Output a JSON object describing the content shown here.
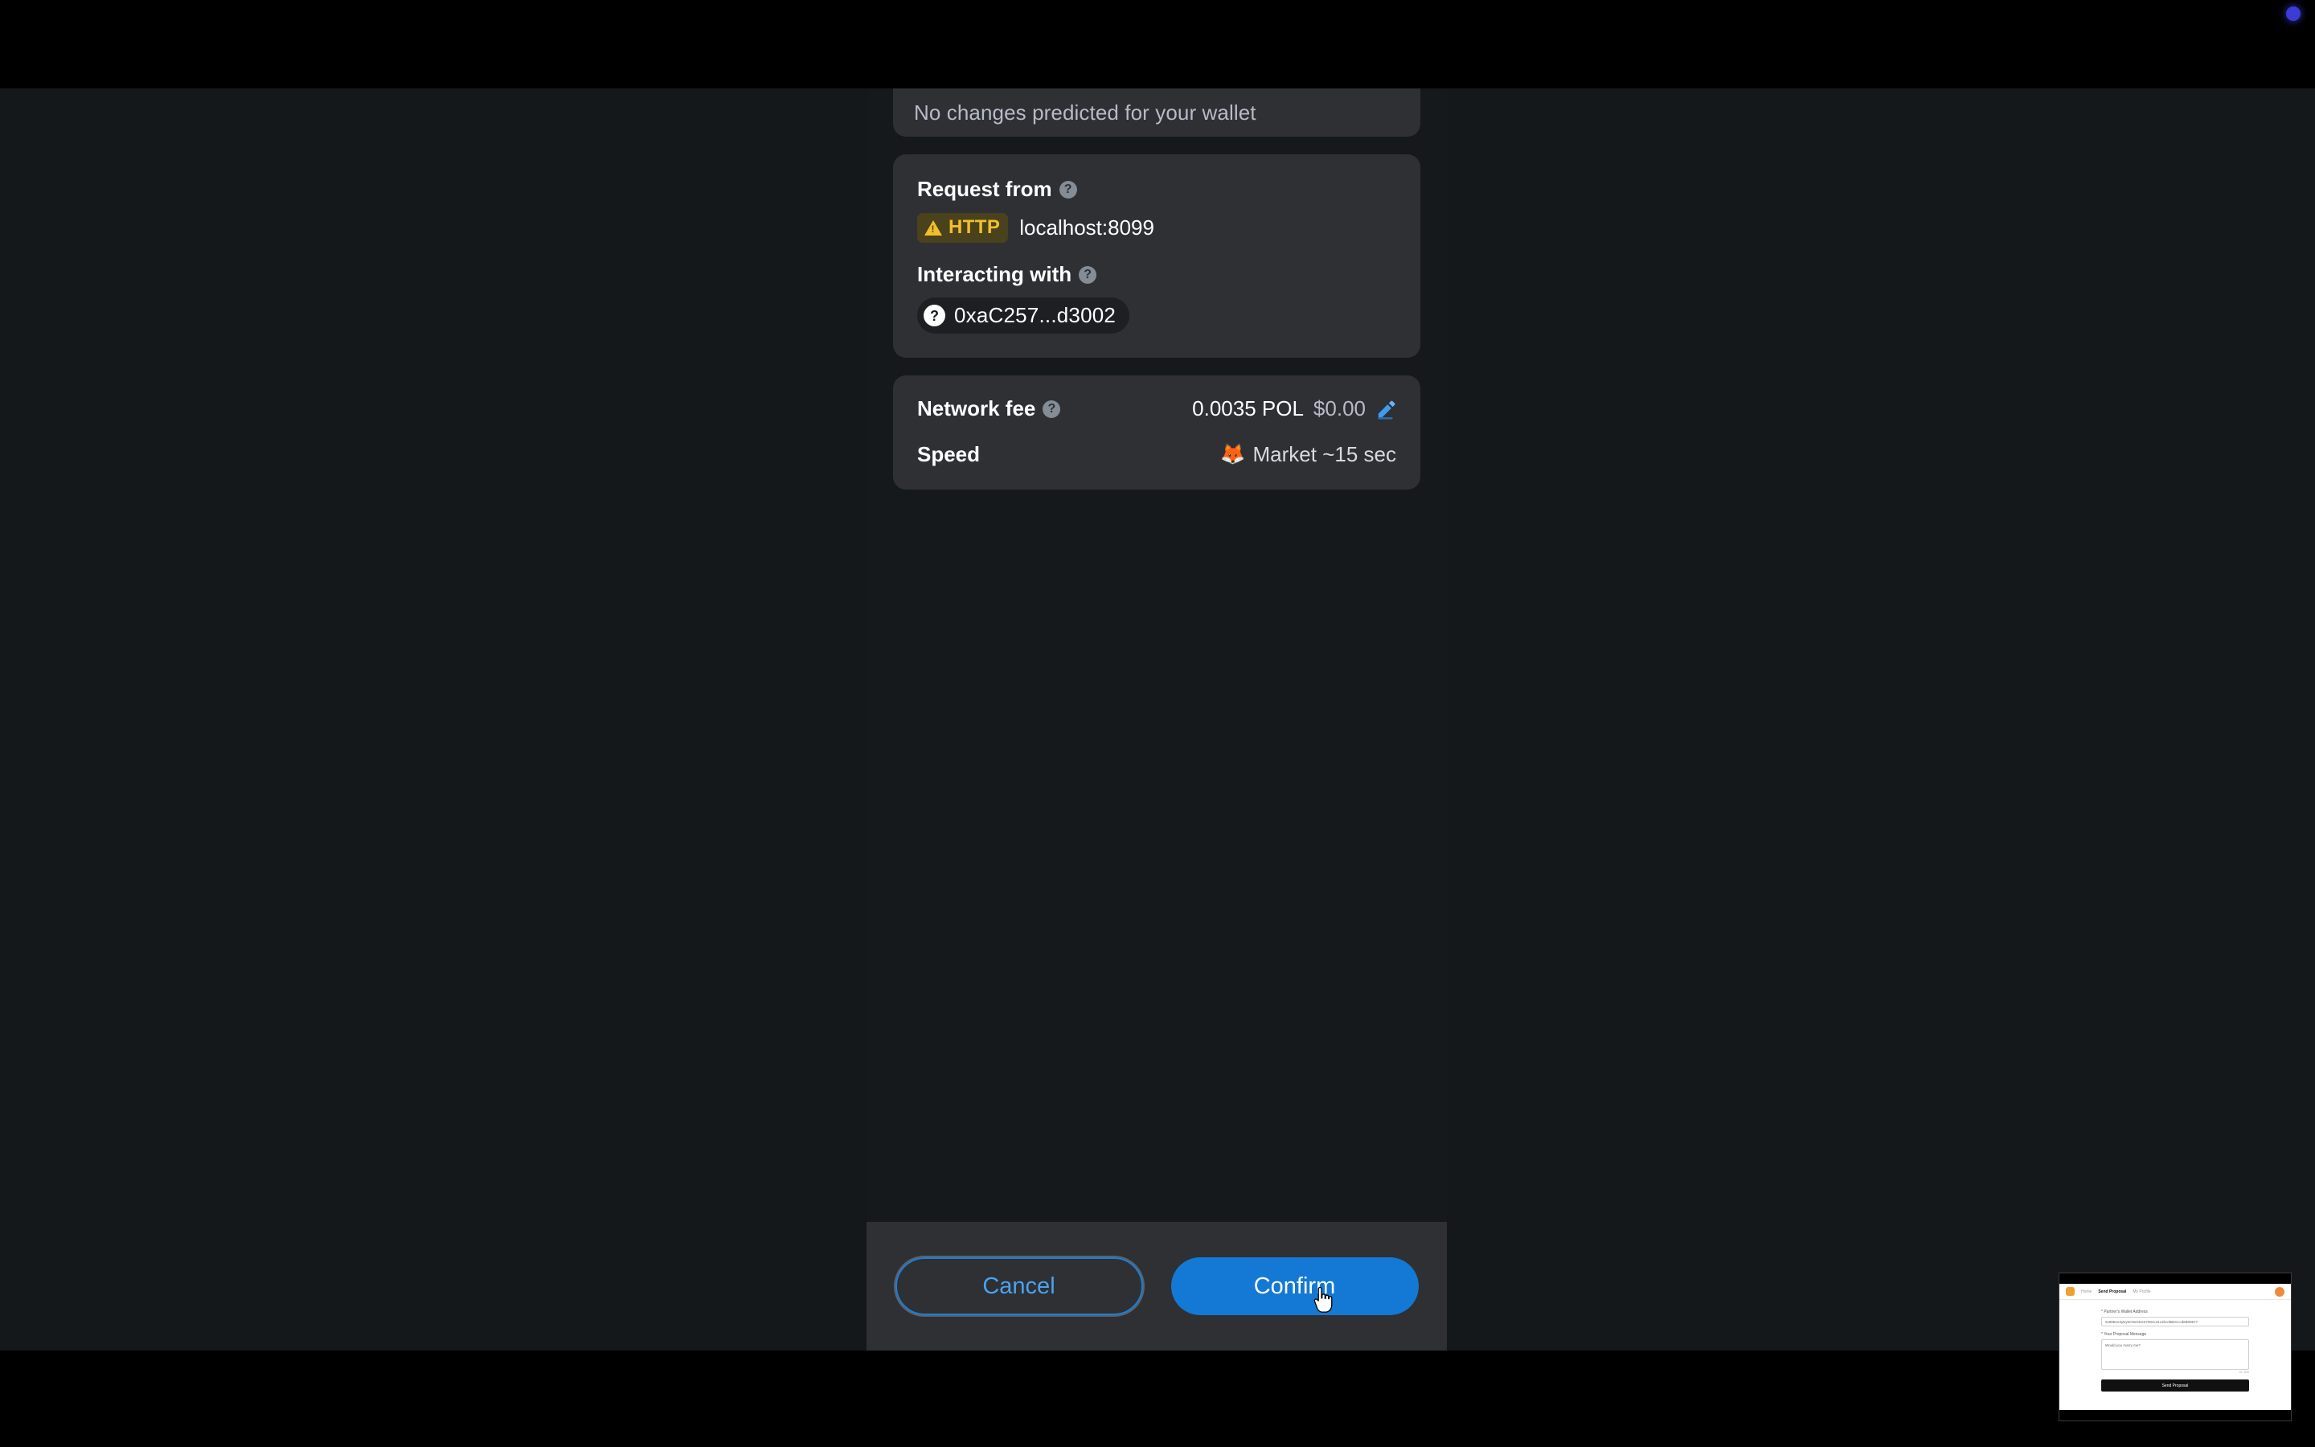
{
  "window": {
    "chrome_dot": "blue-dot"
  },
  "dialog": {
    "simulation": {
      "message": "No changes predicted for your wallet"
    },
    "request": {
      "request_from_label": "Request from",
      "help_icon": "help-circle-icon",
      "protocol_badge": {
        "warning_icon": "warning-triangle-icon",
        "label": "HTTP",
        "color": "#f0c02a"
      },
      "origin": "localhost:8099",
      "interacting_with_label": "Interacting with",
      "contract": {
        "avatar_icon": "unknown-contract-icon",
        "address": "0xaC257...d3002"
      }
    },
    "fee": {
      "network_fee_label": "Network fee",
      "help_icon": "help-circle-icon",
      "fee_amount": "0.0035 POL",
      "fee_fiat": "$0.00",
      "edit_icon": "pencil-edit-icon",
      "speed_label": "Speed",
      "speed_emoji": "🦊",
      "speed_value": "Market ~15 sec"
    },
    "footer": {
      "cancel_label": "Cancel",
      "confirm_label": "Confirm",
      "confirm_color": "#1379d4"
    }
  },
  "thumbnail": {
    "nav": {
      "logo_icon": "app-logo-icon",
      "links": [
        "Home",
        "Send Proposal",
        "My Profile"
      ],
      "avatar_icon": "user-avatar-icon"
    },
    "form": {
      "address_label": "* Partner's Wallet Address",
      "address_value": "0x98Bce3yEy5C9e042c67902c31c2bcd3B0cccd6B09677",
      "message_label": "* Your Proposal Message",
      "message_value": "Would you marry me?",
      "char_count": "19 / 500",
      "submit_icon": "send-icon",
      "submit_label": "Send Proposal"
    }
  },
  "cursor": {
    "icon": "pointer-hand-cursor"
  }
}
